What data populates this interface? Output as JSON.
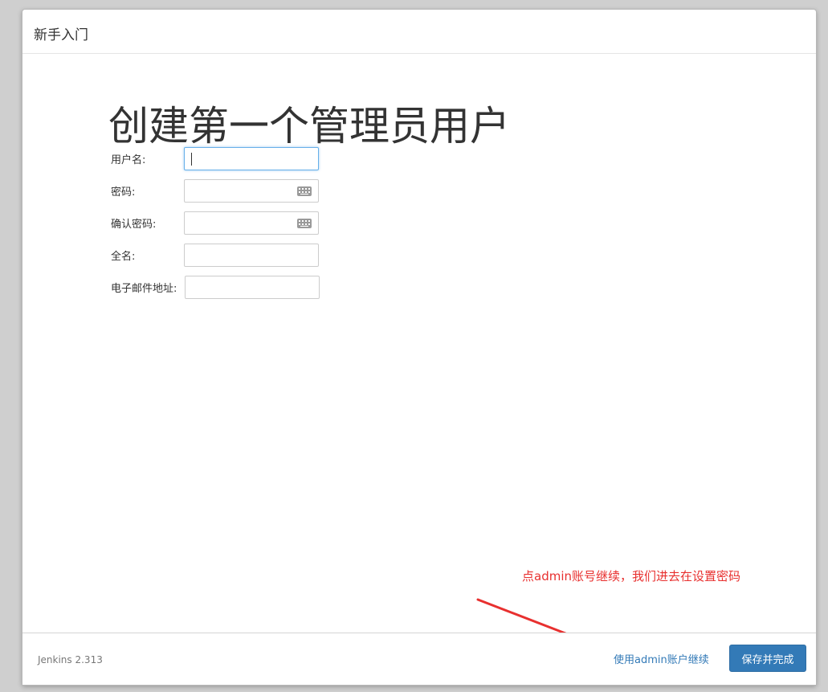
{
  "dialog": {
    "title": "新手入门"
  },
  "main": {
    "heading": "创建第一个管理员用户",
    "fields": [
      {
        "label": "用户名:",
        "value": ""
      },
      {
        "label": "密码:",
        "value": ""
      },
      {
        "label": "确认密码:",
        "value": ""
      },
      {
        "label": "全名:",
        "value": ""
      },
      {
        "label": "电子邮件地址:",
        "value": ""
      }
    ]
  },
  "annotation": {
    "text": "点admin账号继续，我们进去在设置密码",
    "color": "#e8302f"
  },
  "footer": {
    "version": "Jenkins 2.313",
    "continue_link": "使用admin账户继续",
    "save_button": "保存并完成"
  },
  "colors": {
    "accent": "#337ab7",
    "annotation": "#e8302f"
  }
}
